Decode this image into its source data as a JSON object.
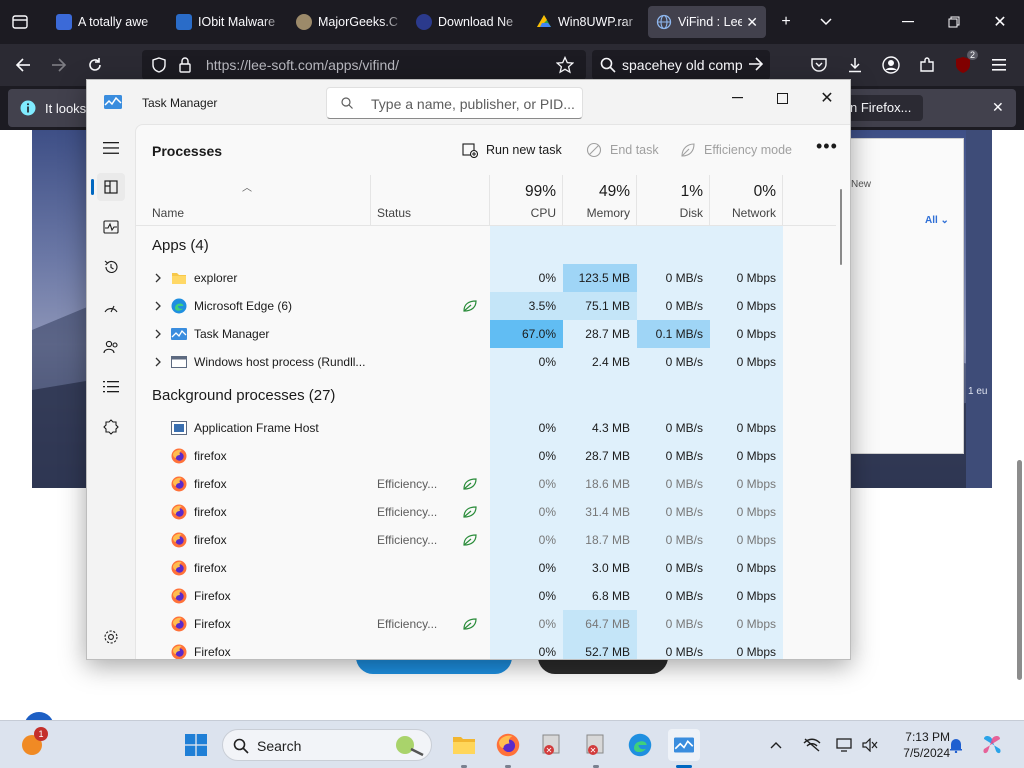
{
  "browser": {
    "tabs": [
      {
        "title": "A totally awe",
        "color": "#3b6ad8"
      },
      {
        "title": "IObit Malware",
        "color": "#2a6cc8"
      },
      {
        "title": "MajorGeeks.C",
        "color": "#9c8a6a"
      },
      {
        "title": "Download Ne",
        "color": "#2b3a8c"
      },
      {
        "title": "Win8UWP.rar",
        "color": "#2ea44f"
      },
      {
        "title": "ViFind : Lee",
        "color": "#6aa0e8"
      }
    ],
    "url": "https://lee-soft.com/apps/vifind/",
    "search_query": "spacehey old compu",
    "extension_badge": "2",
    "notification": {
      "text": "It looks",
      "button": "n Firefox..."
    }
  },
  "page": {
    "card_new": "New",
    "card_all": "All",
    "dark_text": "1 eu"
  },
  "taskmanager": {
    "title": "Task Manager",
    "search_placeholder": "Type a name, publisher, or PID...",
    "section_title": "Processes",
    "commands": {
      "run_new_task": "Run new task",
      "end_task": "End task",
      "efficiency_mode": "Efficiency mode"
    },
    "columns": {
      "name": "Name",
      "status": "Status",
      "cpu": {
        "pct": "99%",
        "label": "CPU"
      },
      "memory": {
        "pct": "49%",
        "label": "Memory"
      },
      "disk": {
        "pct": "1%",
        "label": "Disk"
      },
      "network": {
        "pct": "0%",
        "label": "Network"
      }
    },
    "groups": {
      "apps": "Apps (4)",
      "background": "Background processes (27)"
    },
    "apps": [
      {
        "name": "explorer",
        "status": "",
        "cpu": "0%",
        "memory": "123.5 MB",
        "disk": "0 MB/s",
        "network": "0 Mbps"
      },
      {
        "name": "Microsoft Edge (6)",
        "status": "",
        "cpu": "3.5%",
        "memory": "75.1 MB",
        "disk": "0 MB/s",
        "network": "0 Mbps"
      },
      {
        "name": "Task Manager",
        "status": "",
        "cpu": "67.0%",
        "memory": "28.7 MB",
        "disk": "0.1 MB/s",
        "network": "0 Mbps"
      },
      {
        "name": "Windows host process (Rundll...",
        "status": "",
        "cpu": "0%",
        "memory": "2.4 MB",
        "disk": "0 MB/s",
        "network": "0 Mbps"
      }
    ],
    "background": [
      {
        "name": "Application Frame Host",
        "status": "",
        "cpu": "0%",
        "memory": "4.3 MB",
        "disk": "0 MB/s",
        "network": "0 Mbps"
      },
      {
        "name": "firefox",
        "status": "",
        "cpu": "0%",
        "memory": "28.7 MB",
        "disk": "0 MB/s",
        "network": "0 Mbps"
      },
      {
        "name": "firefox",
        "status": "Efficiency...",
        "cpu": "0%",
        "memory": "18.6 MB",
        "disk": "0 MB/s",
        "network": "0 Mbps"
      },
      {
        "name": "firefox",
        "status": "Efficiency...",
        "cpu": "0%",
        "memory": "31.4 MB",
        "disk": "0 MB/s",
        "network": "0 Mbps"
      },
      {
        "name": "firefox",
        "status": "Efficiency...",
        "cpu": "0%",
        "memory": "18.7 MB",
        "disk": "0 MB/s",
        "network": "0 Mbps"
      },
      {
        "name": "firefox",
        "status": "",
        "cpu": "0%",
        "memory": "3.0 MB",
        "disk": "0 MB/s",
        "network": "0 Mbps"
      },
      {
        "name": "Firefox",
        "status": "",
        "cpu": "0%",
        "memory": "6.8 MB",
        "disk": "0 MB/s",
        "network": "0 Mbps"
      },
      {
        "name": "Firefox",
        "status": "Efficiency...",
        "cpu": "0%",
        "memory": "64.7 MB",
        "disk": "0 MB/s",
        "network": "0 Mbps"
      },
      {
        "name": "Firefox",
        "status": "",
        "cpu": "0%",
        "memory": "52.7 MB",
        "disk": "0 MB/s",
        "network": "0 Mbps"
      }
    ]
  },
  "taskbar": {
    "search_label": "Search",
    "time": "7:13 PM",
    "date": "7/5/2024",
    "notification_count": "1"
  },
  "colors": {
    "accent": "#0067c0",
    "heat_low": "#dff0fb",
    "heat_high": "#61bdf3"
  }
}
